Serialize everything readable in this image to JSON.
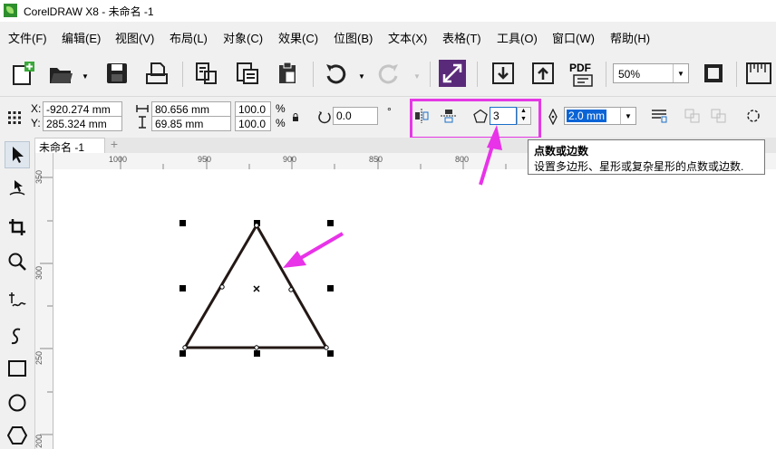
{
  "window": {
    "title": "CorelDRAW X8 - 未命名 -1"
  },
  "menu": [
    "文件(F)",
    "编辑(E)",
    "视图(V)",
    "布局(L)",
    "对象(C)",
    "效果(C)",
    "位图(B)",
    "文本(X)",
    "表格(T)",
    "工具(O)",
    "窗口(W)",
    "帮助(H)"
  ],
  "toolbar": {
    "zoom_value": "50%",
    "pdf_label": "PDF"
  },
  "properties": {
    "x_label": "X:",
    "x_value": "-920.274 mm",
    "y_label": "Y:",
    "y_value": "285.324 mm",
    "width_value": "80.656 mm",
    "height_value": "69.85 mm",
    "scale_w": "100.0",
    "scale_h": "100.0",
    "percent": "%",
    "rotation_value": "0.0",
    "degree": "°",
    "points_value": "3",
    "outline_value": "2.0 mm"
  },
  "document": {
    "tab_name": "未命名 -1",
    "add_tab": "+"
  },
  "ruler": {
    "h_labels": [
      "1000",
      "950",
      "900",
      "850",
      "800"
    ],
    "v_labels": [
      "350",
      "300",
      "250",
      "200"
    ]
  },
  "tooltip": {
    "title": "点数或边数",
    "description": "设置多边形、星形或复杂星形的点数或边数."
  },
  "colors": {
    "highlight": "#e638e6",
    "arrow": "#e833e8",
    "selection": "#0a64d6"
  }
}
